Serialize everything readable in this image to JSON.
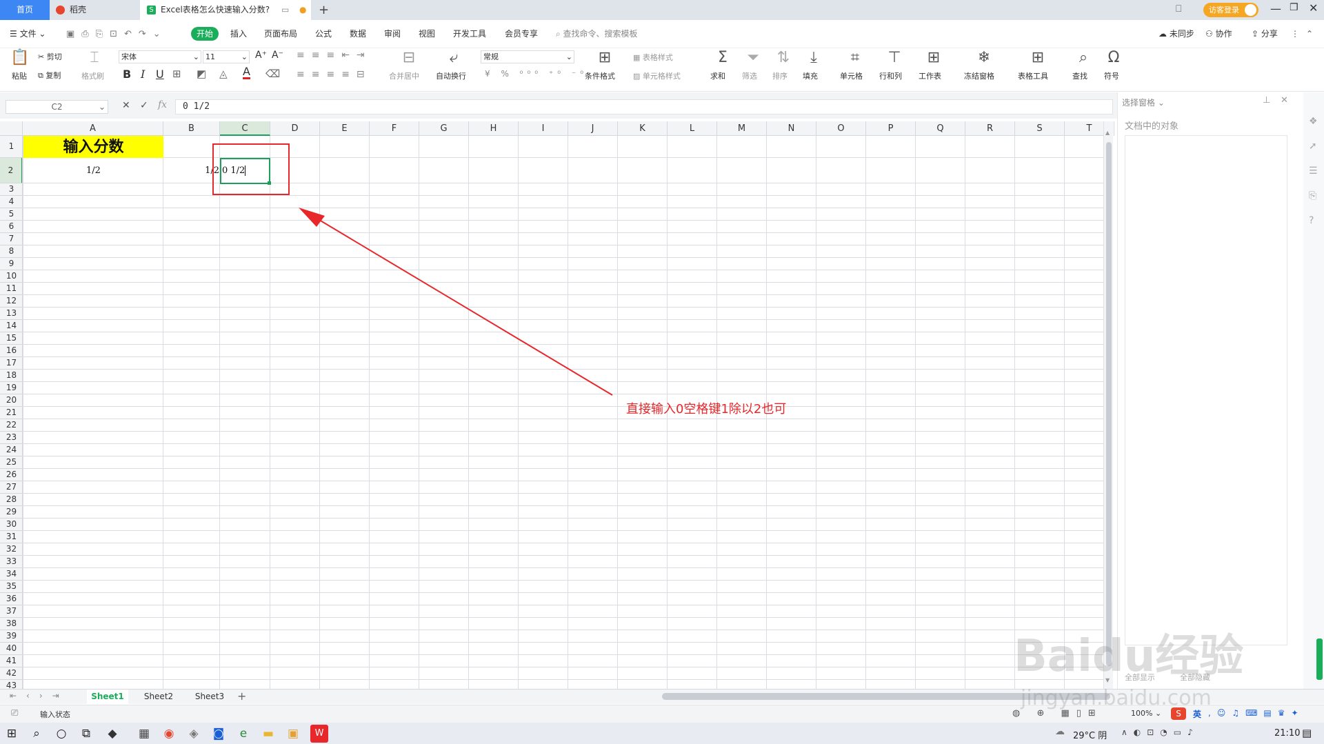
{
  "tabs": {
    "home": "首页",
    "daoke": "稻壳",
    "doc": "Excel表格怎么快速输入分数?",
    "add": "+"
  },
  "titlebar": {
    "login": "访客登录"
  },
  "menu": {
    "file": "文件",
    "start": "开始",
    "insert": "插入",
    "layout": "页面布局",
    "formula": "公式",
    "data": "数据",
    "review": "审阅",
    "view": "视图",
    "dev": "开发工具",
    "member": "会员专享",
    "search": "查找命令、搜索模板",
    "unsync": "未同步",
    "collab": "协作",
    "share": "分享"
  },
  "ribbon": {
    "paste": "粘贴",
    "cut": "剪切",
    "copy": "复制",
    "format_painter": "格式刷",
    "font": "宋体",
    "size": "11",
    "merge": "合并居中",
    "wrap": "自动换行",
    "numfmt": "常规",
    "cond": "条件格式",
    "table_style": "表格样式",
    "cell_style": "单元格样式",
    "sum": "求和",
    "filter": "筛选",
    "sort": "排序",
    "fill": "填充",
    "cell": "单元格",
    "rowcol": "行和列",
    "sheet": "工作表",
    "freeze": "冻结窗格",
    "table_tools": "表格工具",
    "find": "查找",
    "symbol": "符号"
  },
  "formula": {
    "namebox": "C2",
    "fx": "fx",
    "value": "0 1/2"
  },
  "columns": [
    "A",
    "B",
    "C",
    "D",
    "E",
    "F",
    "G",
    "H",
    "I",
    "J",
    "K",
    "L",
    "M",
    "N",
    "O",
    "P",
    "Q",
    "R",
    "S",
    "T"
  ],
  "rows": [
    "1",
    "2",
    "3",
    "4",
    "5",
    "6",
    "7",
    "8",
    "9",
    "10",
    "11",
    "12",
    "13",
    "14",
    "15",
    "16",
    "17",
    "18",
    "19",
    "20",
    "21",
    "22",
    "23",
    "24",
    "25",
    "26",
    "27",
    "28",
    "29",
    "30",
    "31",
    "32",
    "33",
    "34",
    "35",
    "36",
    "37",
    "38",
    "39",
    "40",
    "41",
    "42",
    "43"
  ],
  "cells": {
    "a1": "输入分数",
    "a2": "1/2",
    "b2": "1/2",
    "c2": "0 1/2"
  },
  "annotation": {
    "text": "直接输入0空格键1除以2也可",
    "color": "#e8272b"
  },
  "panel": {
    "title": "选择窗格",
    "subtitle": "文档中的对象",
    "show_all": "全部显示",
    "hide_all": "全部隐藏"
  },
  "sheets": [
    "Sheet1",
    "Sheet2",
    "Sheet3"
  ],
  "status": {
    "mode": "输入状态",
    "zoom": "100%"
  },
  "taskbar": {
    "weather": "29°C 阴",
    "time": "21:10",
    "ime": "英"
  },
  "watermark": {
    "brand": "Baidu经验",
    "url": "jingyan.baidu.com"
  },
  "colors": {
    "accent": "#3d87f5",
    "start_green": "#1aad5a",
    "header_yellow": "#ffff00",
    "select_green": "#1e9e5b",
    "annotation_red": "#e8272b"
  }
}
